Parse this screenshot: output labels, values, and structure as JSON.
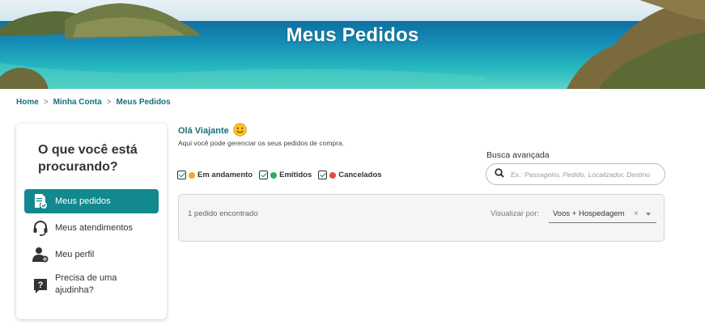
{
  "hero": {
    "title": "Meus Pedidos"
  },
  "breadcrumb": [
    {
      "label": "Home"
    },
    {
      "label": "Minha Conta"
    },
    {
      "label": "Meus Pedidos"
    }
  ],
  "breadcrumb_separator": ">",
  "sidebar": {
    "title": "O que você está procurando?",
    "items": [
      {
        "label": "Meus pedidos",
        "icon": "document-check-icon",
        "active": true
      },
      {
        "label": "Meus atendimentos",
        "icon": "headset-icon",
        "active": false
      },
      {
        "label": "Meu perfil",
        "icon": "user-gear-icon",
        "active": false
      },
      {
        "label": "Precisa de uma ajudinha?",
        "icon": "question-chat-icon",
        "active": false
      }
    ]
  },
  "greeting": {
    "title": "Olá Viajante",
    "emoji": "smile-emoji-icon",
    "subtitle": "Aqui você pode gerenciar os seus pedidos de compra."
  },
  "filters": [
    {
      "label": "Em andamento",
      "color": "#f5a623",
      "checked": true
    },
    {
      "label": "Emitidos",
      "color": "#27ae60",
      "checked": true
    },
    {
      "label": "Cancelados",
      "color": "#e74c3c",
      "checked": true
    }
  ],
  "search": {
    "label": "Busca avançada",
    "placeholder": "Ex.: Passageiro, Pedido, Localizador, Destino"
  },
  "results": {
    "count_text": "1 pedido encontrado",
    "view_label": "Visualizar por:",
    "view_value": "Voos + Hospedagem",
    "clear_symbol": "×"
  },
  "colors": {
    "accent": "#12898f",
    "link": "#1a6f7a"
  }
}
